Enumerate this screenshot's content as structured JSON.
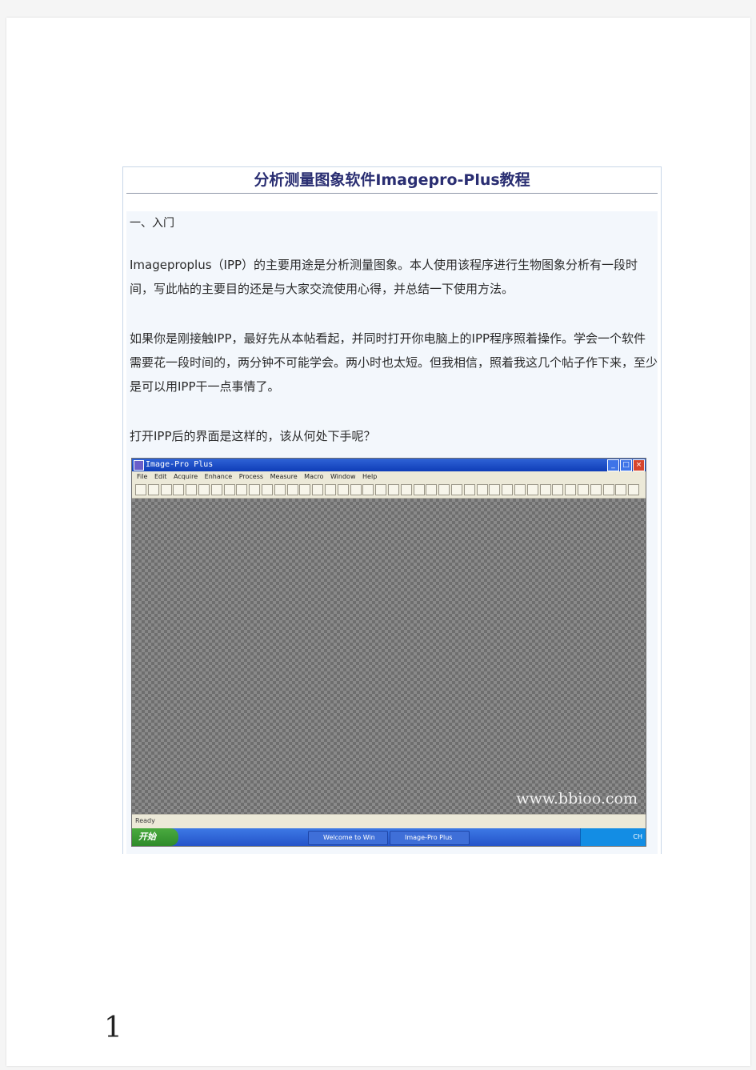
{
  "article": {
    "title": "分析测量图象软件Imagepro-Plus教程",
    "section_heading": "一、入门",
    "paragraph_1": "Imageproplus（IPP）的主要用途是分析测量图象。本人使用该程序进行生物图象分析有一段时间，写此帖的主要目的还是与大家交流使用心得，并总结一下使用方法。",
    "paragraph_2": "如果你是刚接触IPP，最好先从本帖看起，并同时打开你电脑上的IPP程序照着操作。学会一个软件需要花一段时间的，两分钟不可能学会。两小时也太短。但我相信，照着我这几个帖子作下来，至少是可以用IPP干一点事情了。",
    "paragraph_3": "打开IPP后的界面是这样的，该从何处下手呢？"
  },
  "screenshot": {
    "window_title": "Image-Pro Plus",
    "menu_items": [
      "File",
      "Edit",
      "Acquire",
      "Enhance",
      "Process",
      "Measure",
      "Macro",
      "Window",
      "Help"
    ],
    "taskbar": {
      "start_label": "开始",
      "tasks": [
        "Welcome to Win",
        "Image-Pro Plus"
      ],
      "tray_text": "CH"
    },
    "status_left": "Ready",
    "watermark": "www.bbioo.com"
  },
  "page_number": "1",
  "colors": {
    "title": "#2a2e72",
    "body_background": "#f3f7fc",
    "titlebar_blue": "#0f3db8"
  }
}
